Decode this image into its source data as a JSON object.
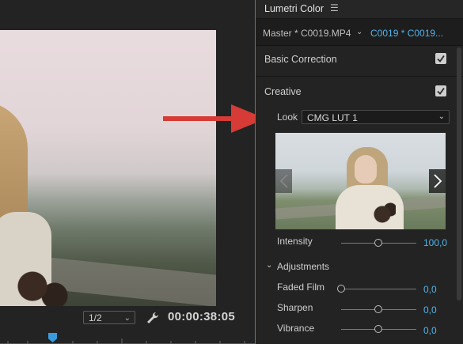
{
  "monitor": {
    "resolution": "1/2",
    "timecode": "00:00:38:05"
  },
  "panel": {
    "title": "Lumetri Color",
    "menu_icon": "hamburger-menu-icon",
    "master_clip": "Master * C0019.MP4",
    "sequence_clip": "C0019 * C0019...",
    "accent_color": "#4fb4ec",
    "arrow_color": "#d63b35"
  },
  "basic_correction": {
    "title": "Basic Correction",
    "enabled": true
  },
  "creative": {
    "title": "Creative",
    "enabled": true,
    "look_label": "Look",
    "look_value": "CMG LUT 1",
    "intensity_label": "Intensity",
    "intensity_value": "100,0",
    "adjustments_title": "Adjustments",
    "sliders": [
      {
        "label": "Faded Film",
        "value": "0,0",
        "position": 0.0
      },
      {
        "label": "Sharpen",
        "value": "0,0",
        "position": 0.5
      },
      {
        "label": "Vibrance",
        "value": "0,0",
        "position": 0.5
      }
    ],
    "intensity_position": 0.5
  }
}
